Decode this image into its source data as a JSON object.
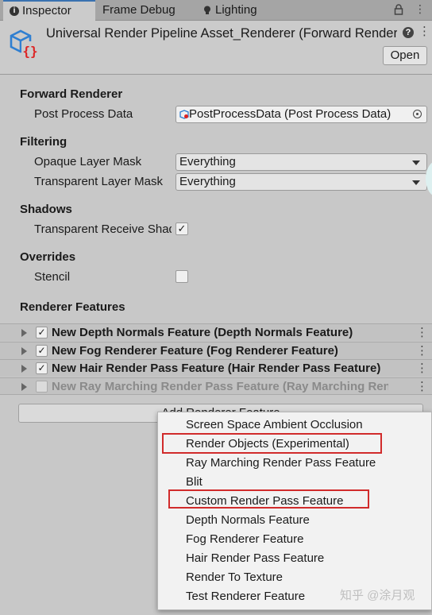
{
  "tabs": [
    {
      "label": "Inspector",
      "icon": "info-icon",
      "active": true
    },
    {
      "label": "Frame Debug",
      "active": false
    },
    {
      "label": "Lighting",
      "icon": "lightbulb-icon",
      "active": false
    }
  ],
  "header": {
    "title": "Universal Render Pipeline Asset_Renderer (Forward Renderer)",
    "open_label": "Open",
    "help_glyph": "?",
    "menu_glyph": "⋮"
  },
  "sections": {
    "forward_renderer": "Forward Renderer",
    "filtering": "Filtering",
    "shadows": "Shadows",
    "overrides": "Overrides",
    "renderer_features": "Renderer Features"
  },
  "fields": {
    "post_process_label": "Post Process Data",
    "post_process_value": "PostProcessData (Post Process Data)",
    "opaque_label": "Opaque Layer Mask",
    "opaque_value": "Everything",
    "transparent_label": "Transparent Layer Mask",
    "transparent_value": "Everything",
    "receive_shadows_label": "Transparent Receive Shadows",
    "receive_shadows_checked": true,
    "stencil_label": "Stencil",
    "stencil_checked": false
  },
  "renderer_features": [
    {
      "name": "New Depth Normals Feature (Depth Normals Feature)",
      "enabled": true
    },
    {
      "name": "New Fog Renderer Feature (Fog Renderer Feature)",
      "enabled": true
    },
    {
      "name": "New Hair Render Pass Feature (Hair Render Pass Feature)",
      "enabled": true
    },
    {
      "name": "New Ray Marching Render Pass Feature (Ray Marching Render Pass Feature)",
      "enabled": false
    }
  ],
  "add_button_label": "Add Renderer Feature",
  "menu_items": [
    "Screen Space Ambient Occlusion",
    "Render Objects (Experimental)",
    "Ray Marching Render Pass Feature",
    "Blit",
    "Custom Render Pass Feature",
    "Depth Normals Feature",
    "Fog Renderer Feature",
    "Hair Render Pass Feature",
    "Render To Texture",
    "Test Renderer Feature"
  ],
  "check_glyph": "✓",
  "kebab_glyph": "⋮",
  "lock_glyph": "🔒",
  "highlight_color": "#d12b2b",
  "watermark": "知乎 @涂月观"
}
